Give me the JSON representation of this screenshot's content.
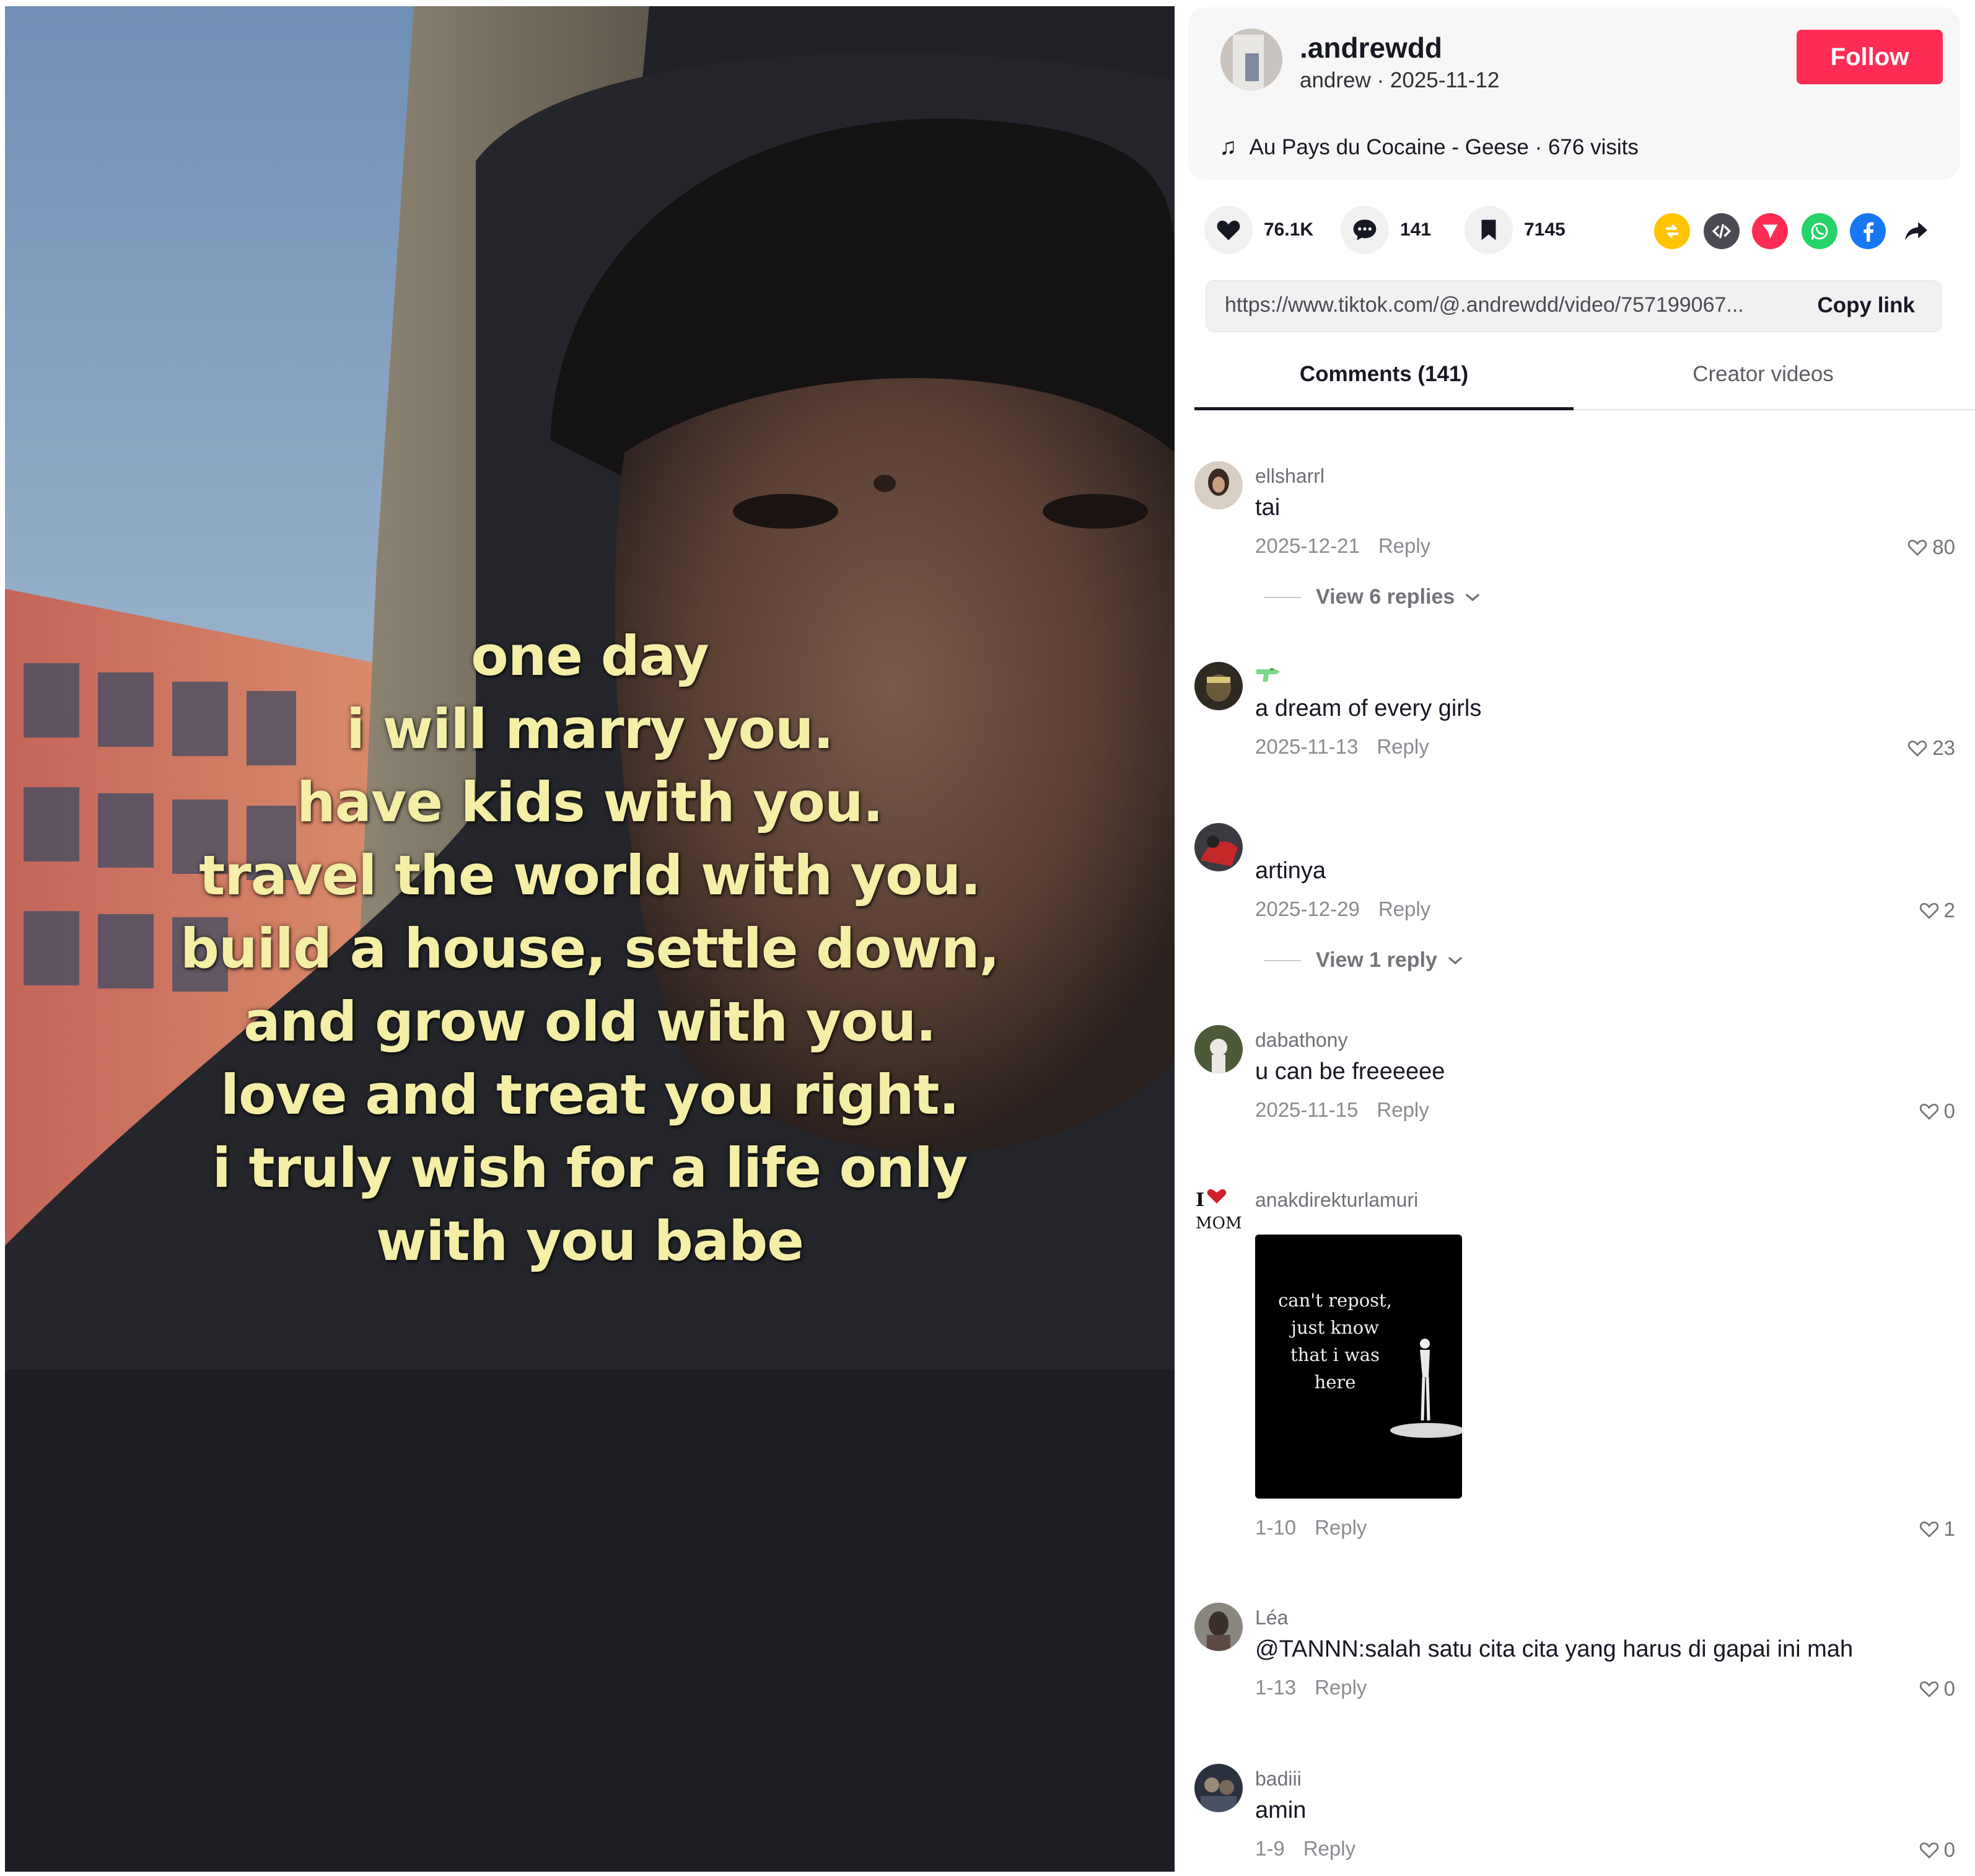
{
  "video": {
    "caption_lines": [
      "one day",
      "i will marry you.",
      "have kids with you.",
      "travel the world with you.",
      "build a house, settle down,",
      "and grow old with you.",
      "love and treat you right.",
      "i truly wish for a life only",
      "with you babe"
    ]
  },
  "creator": {
    "username": ".andrewdd",
    "meta": "andrew · 2025-11-12",
    "follow_label": "Follow",
    "music": "Au Pays du Cocaine - Geese · 676 visits",
    "music_icon": "music-note-icon"
  },
  "stats": {
    "likes": "76.1K",
    "comments": "141",
    "saves": "7145"
  },
  "share_icons": [
    "repost-icon",
    "embed-icon",
    "send-icon",
    "whatsapp-icon",
    "facebook-icon",
    "share-arrow-icon"
  ],
  "colors": {
    "follow": "#fe2c55",
    "repost": "#ffc300",
    "embed": "#4a4b52",
    "send": "#fe2c55",
    "whatsapp": "#25d366",
    "facebook": "#1877f2",
    "caption": "#f4eea6"
  },
  "link": {
    "url": "https://www.tiktok.com/@.andrewdd/video/757199067...",
    "copy_label": "Copy link"
  },
  "tabs": {
    "comments": "Comments (141)",
    "creator_videos": "Creator videos"
  },
  "comments": [
    {
      "user": "ellsharrl",
      "text": "tai",
      "date": "2025-12-21",
      "reply": "Reply",
      "likes": "80",
      "view_replies": "View 6 replies"
    },
    {
      "user": "",
      "text": "a dream of every girls",
      "date": "2025-11-13",
      "reply": "Reply",
      "likes": "23"
    },
    {
      "user": "",
      "text": "artinya",
      "date": "2025-12-29",
      "reply": "Reply",
      "likes": "2",
      "view_replies": "View 1 reply"
    },
    {
      "user": "dabathony",
      "text": "u can be freeeeee",
      "date": "2025-11-15",
      "reply": "Reply",
      "likes": "0"
    },
    {
      "user": "anakdirekturlamuri",
      "sticker_text": "can't repost, just know that i was here",
      "date": "1-10",
      "reply": "Reply",
      "likes": "1"
    },
    {
      "user": "Léa",
      "text": "@TANNN:salah satu cita cita yang harus di gapai ini mah",
      "date": "1-13",
      "reply": "Reply",
      "likes": "0"
    },
    {
      "user": "badiii",
      "text": "amin",
      "date": "1-9",
      "reply": "Reply",
      "likes": "0"
    }
  ]
}
